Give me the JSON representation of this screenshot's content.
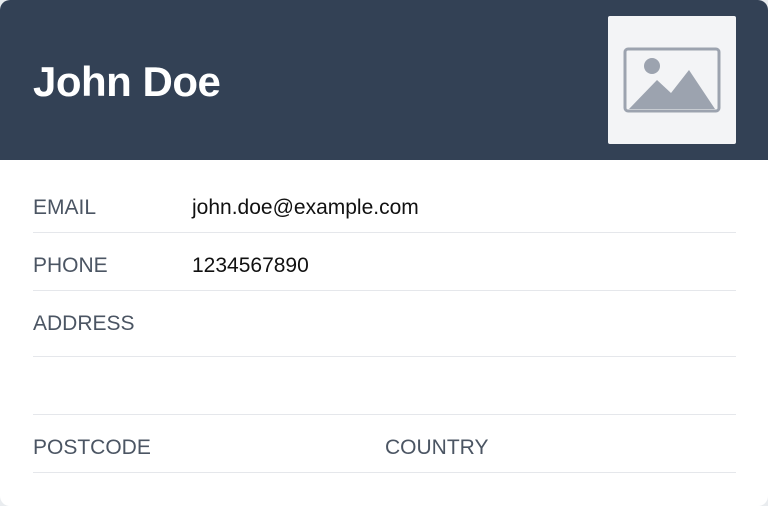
{
  "contact": {
    "name": "John Doe",
    "photo_icon": "image-placeholder-icon"
  },
  "fields": {
    "email": {
      "label": "EMAIL",
      "value": "john.doe@example.com"
    },
    "phone": {
      "label": "PHONE",
      "value": "1234567890"
    },
    "address": {
      "label": "ADDRESS",
      "value": ""
    },
    "address_line2": {
      "value": ""
    },
    "postcode": {
      "label": "POSTCODE",
      "value": ""
    },
    "country": {
      "label": "COUNTRY",
      "value": ""
    }
  },
  "colors": {
    "header_bg": "#334155",
    "card_bg": "#ffffff",
    "label_text": "#4b5563",
    "divider": "#e5e7eb"
  }
}
